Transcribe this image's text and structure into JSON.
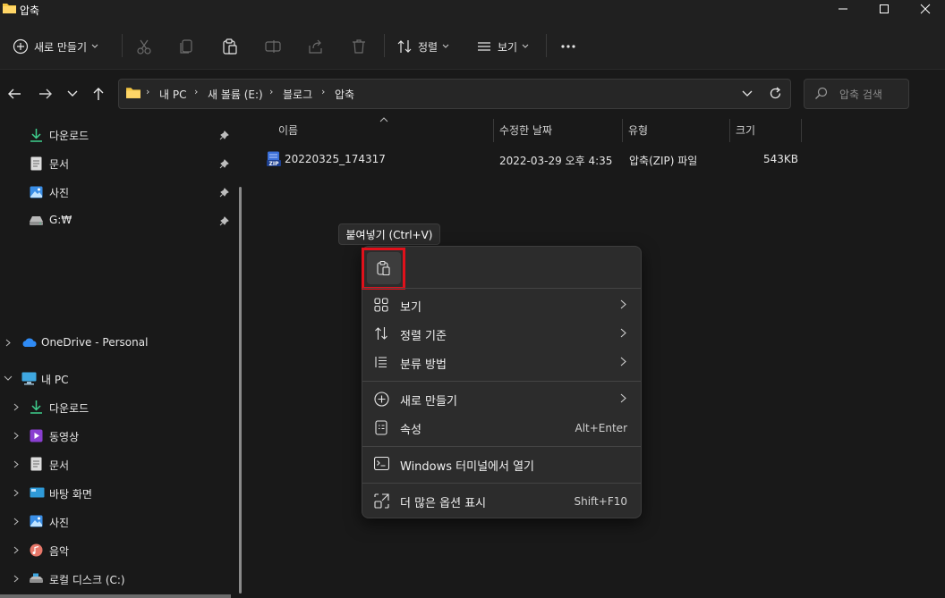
{
  "window": {
    "title": "압축",
    "controls": [
      "minimize-icon",
      "maximize-icon",
      "close-icon"
    ]
  },
  "toolbar": {
    "new_label": "새로 만들기",
    "sort_label": "정렬",
    "view_label": "보기",
    "icons": [
      "cut-icon",
      "copy-icon",
      "paste-icon",
      "rename-icon",
      "share-icon",
      "delete-icon",
      "more-icon"
    ]
  },
  "breadcrumb": [
    "내 PC",
    "새 볼륨 (E:)",
    "블로그",
    "압축"
  ],
  "search": {
    "placeholder": "압축 검색"
  },
  "quick_access": [
    {
      "label": "다운로드",
      "icon": "download-icon"
    },
    {
      "label": "문서",
      "icon": "document-icon"
    },
    {
      "label": "사진",
      "icon": "pictures-icon"
    },
    {
      "label": "G:₩",
      "icon": "drive-icon"
    }
  ],
  "nav_tree": {
    "onedrive": "OneDrive - Personal",
    "this_pc": "내 PC",
    "children": [
      {
        "label": "다운로드",
        "icon": "download-icon"
      },
      {
        "label": "동영상",
        "icon": "video-icon"
      },
      {
        "label": "문서",
        "icon": "document-icon"
      },
      {
        "label": "바탕 화면",
        "icon": "desktop-icon"
      },
      {
        "label": "사진",
        "icon": "pictures-icon"
      },
      {
        "label": "음악",
        "icon": "music-icon"
      },
      {
        "label": "로컬 디스크 (C:)",
        "icon": "disk-icon"
      }
    ]
  },
  "columns": [
    "이름",
    "수정한 날짜",
    "유형",
    "크기"
  ],
  "files": [
    {
      "name": "20220325_174317",
      "modified": "2022-03-29 오후 4:35",
      "type": "압축(ZIP) 파일",
      "size": "543KB"
    }
  ],
  "tooltip": "붙여넣기 (Ctrl+V)",
  "context_menu": {
    "items": [
      {
        "label": "보기",
        "has_submenu": true
      },
      {
        "label": "정렬 기준",
        "has_submenu": true
      },
      {
        "label": "분류 방법",
        "has_submenu": true
      },
      {
        "label": "새로 만들기",
        "has_submenu": true
      },
      {
        "label": "속성",
        "shortcut": "Alt+Enter"
      },
      {
        "label": "Windows 터미널에서 열기"
      },
      {
        "label": "더 많은 옵션 표시",
        "shortcut": "Shift+F10"
      }
    ]
  },
  "colors": {
    "highlight": "#e0111b",
    "folder": "#f4c542",
    "accent": "#4cc2ff"
  }
}
